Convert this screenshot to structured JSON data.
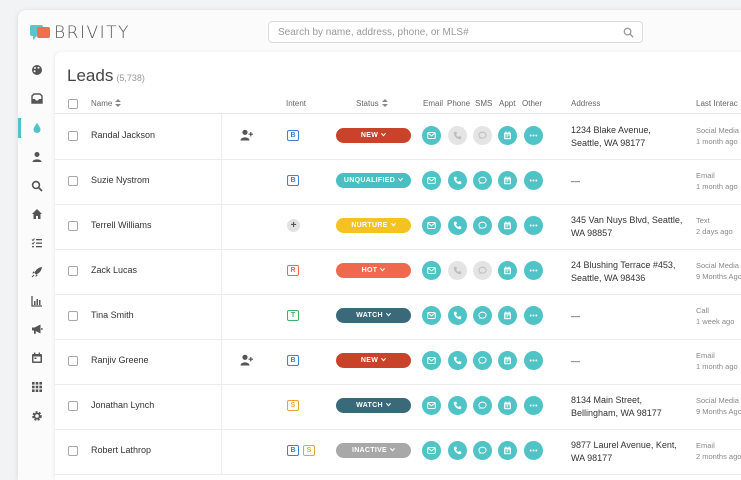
{
  "app": {
    "logo_text": "BRIVITY"
  },
  "search": {
    "placeholder": "Search by name, address, phone, or MLS#"
  },
  "page": {
    "title": "Leads",
    "count": "(5,738)"
  },
  "columns": {
    "name": "Name",
    "intent": "Intent",
    "status": "Status",
    "email": "Email",
    "phone": "Phone",
    "sms": "SMS",
    "appt": "Appt",
    "other": "Other",
    "address": "Address",
    "last_interaction": "Last Interac"
  },
  "colors": {
    "accent": "#4fc3c6",
    "status_new": "#c9432b",
    "status_unqualified": "#49bfc2",
    "status_nurture": "#f4c321",
    "status_hot": "#ef6a4c",
    "status_watch": "#3a6a7a",
    "status_inactive": "#a8a8a8",
    "tag_b": "#3f7fd4",
    "tag_r": "#e86a4f",
    "tag_t": "#3fae6a",
    "tag_s": "#e9a23b"
  },
  "sidebar_icons": [
    "palette-icon",
    "inbox-icon",
    "leads-drop-icon",
    "person-icon",
    "search-icon",
    "home-icon",
    "tasks-icon",
    "rocket-icon",
    "reports-icon",
    "megaphone-icon",
    "calendar-icon",
    "apps-grid-icon",
    "settings-gear-icon"
  ],
  "leads": [
    {
      "name": "Randal Jackson",
      "person_icon": true,
      "intent": [
        "B"
      ],
      "status": "NEW",
      "status_key": "status_new",
      "phone": false,
      "sms": false,
      "address_line1": "1234 Blake Avenue,",
      "address_line2": "Seattle, WA 98177",
      "last_type": "Social Media",
      "last_time": "1 month ago"
    },
    {
      "name": "Suzie Nystrom",
      "person_icon": false,
      "intent": [
        "B"
      ],
      "status": "UNQUALIFIED",
      "status_key": "status_unqualified",
      "phone": true,
      "sms": true,
      "address_line1": "—",
      "address_line2": "",
      "last_type": "Email",
      "last_time": "1 month ago"
    },
    {
      "name": "Terrell Williams",
      "person_icon": false,
      "intent": [
        "+"
      ],
      "status": "NURTURE",
      "status_key": "status_nurture",
      "phone": true,
      "sms": true,
      "address_line1": "345 Van Nuys Blvd, Seattle,",
      "address_line2": "WA 98857",
      "last_type": "Text",
      "last_time": "2 days ago"
    },
    {
      "name": "Zack Lucas",
      "person_icon": false,
      "intent": [
        "R"
      ],
      "status": "HOT",
      "status_key": "status_hot",
      "phone": false,
      "sms": false,
      "address_line1": "24 Blushing Terrace #453,",
      "address_line2": "Seattle, WA 98436",
      "last_type": "Social Media",
      "last_time": "9 Months Ago"
    },
    {
      "name": "Tina Smith",
      "person_icon": false,
      "intent": [
        "T"
      ],
      "status": "WATCH",
      "status_key": "status_watch",
      "phone": true,
      "sms": true,
      "address_line1": "—",
      "address_line2": "",
      "last_type": "Call",
      "last_time": "1 week ago"
    },
    {
      "name": "Ranjiv Greene",
      "person_icon": true,
      "intent": [
        "B"
      ],
      "status": "NEW",
      "status_key": "status_new",
      "phone": true,
      "sms": true,
      "address_line1": "—",
      "address_line2": "",
      "last_type": "Email",
      "last_time": "1 month ago"
    },
    {
      "name": "Jonathan Lynch",
      "person_icon": false,
      "intent": [
        "S"
      ],
      "status": "WATCH",
      "status_key": "status_watch",
      "phone": true,
      "sms": true,
      "address_line1": "8134 Main Street,",
      "address_line2": "Bellingham, WA 98177",
      "last_type": "Social Media",
      "last_time": "9 Months Ago"
    },
    {
      "name": "Robert Lathrop",
      "person_icon": false,
      "intent": [
        "B",
        "S"
      ],
      "status": "INACTIVE",
      "status_key": "status_inactive",
      "phone": true,
      "sms": true,
      "address_line1": "9877 Laurel Avenue, Kent,",
      "address_line2": "WA 98177",
      "last_type": "Email",
      "last_time": "2 months ago"
    }
  ]
}
